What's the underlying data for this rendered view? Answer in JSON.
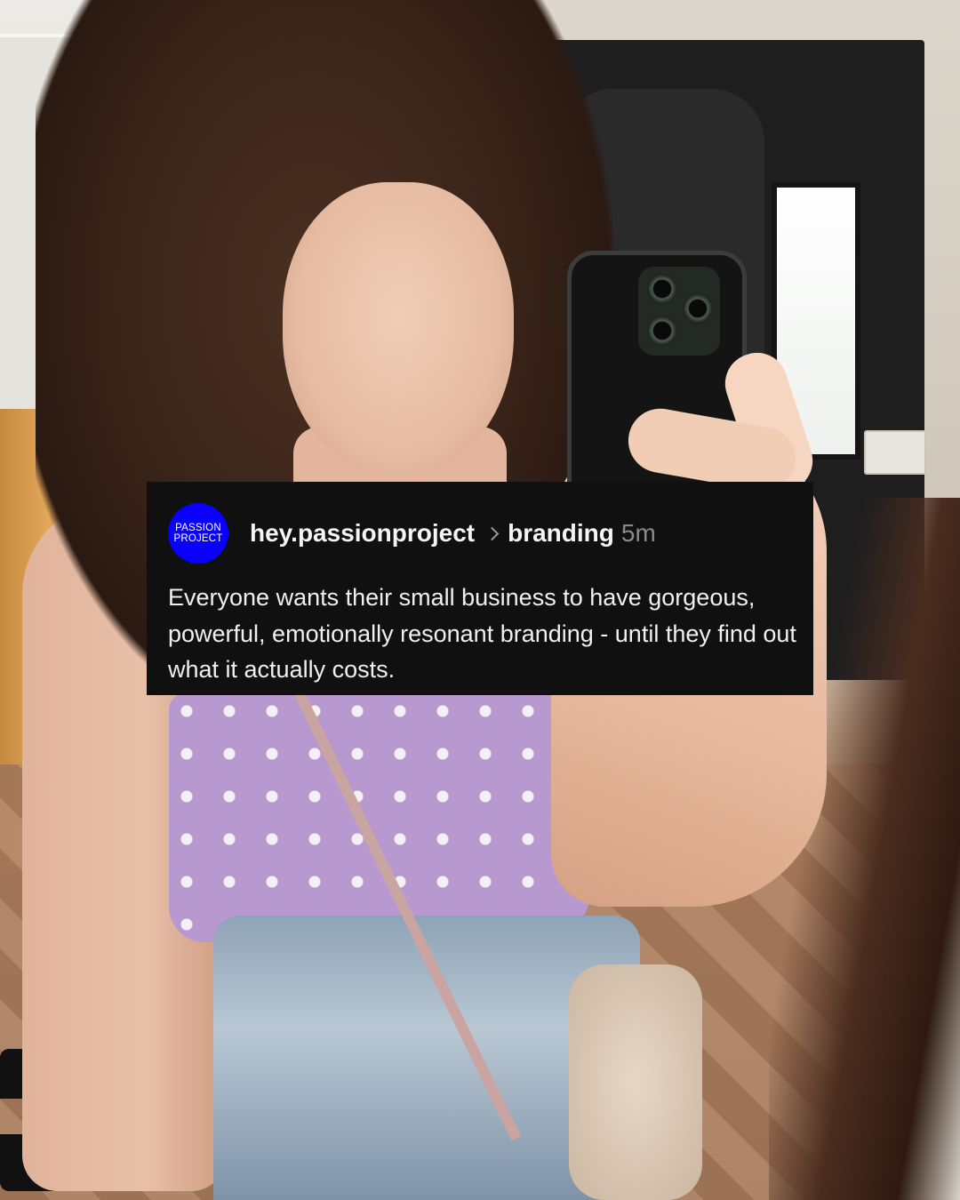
{
  "post": {
    "avatar_text_line1": "PASSION",
    "avatar_text_line2": "PROJECT",
    "avatar_color": "#0a00ff",
    "username": "hey.passionproject",
    "topic": "branding",
    "time": "5m",
    "text": "Everyone wants their small business to have gorgeous, powerful, emotionally resonant branding - until they find out what it actually costs."
  },
  "background": {
    "image_icon": "mirror-selfie-photo"
  }
}
